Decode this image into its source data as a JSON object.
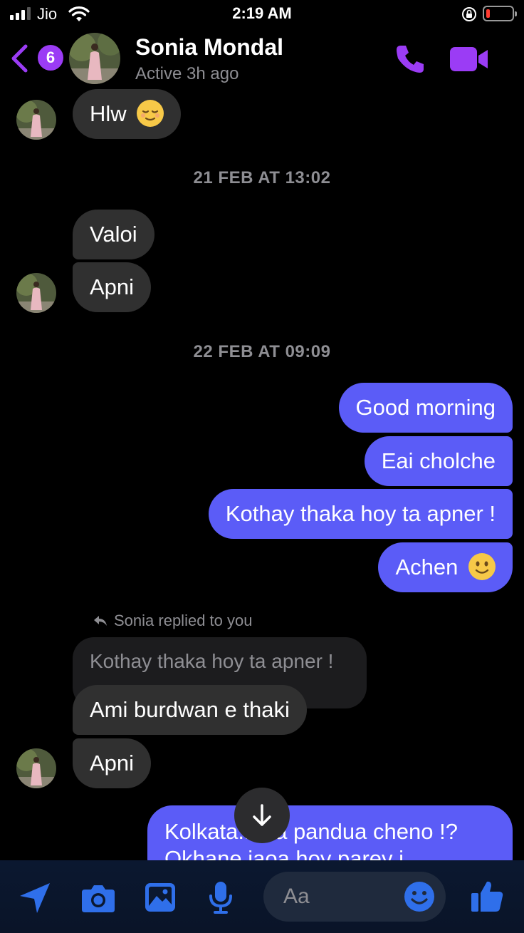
{
  "status_bar": {
    "carrier": "Jio",
    "time": "2:19 AM",
    "battery_color": "#ff3b30"
  },
  "header": {
    "unread_count": "6",
    "name": "Sonia Mondal",
    "status": "Active 3h ago"
  },
  "colors": {
    "accent": "#9b3cf5",
    "outgoing_bubble": "#5b5cf7",
    "incoming_bubble": "#303030"
  },
  "messages": {
    "m1": "Hlw",
    "date1": "21 FEB AT 13:02",
    "m2": "Valoi",
    "m3": "Apni",
    "date2": "22 FEB AT 09:09",
    "m4": "Good morning",
    "m5": "Eai cholche",
    "m6": "Kothay thaka hoy ta apner !",
    "m7": "Achen",
    "reply_label": "Sonia replied to you",
    "quoted": "Kothay thaka hoy ta apner !",
    "m8": "Ami burdwan e thaki",
    "m9": "Apni",
    "m10_line1": "Kolkata... na pandua cheno !?",
    "m10_line2": "Okhane jaoa hoy parey i..."
  },
  "composer": {
    "placeholder": "Aa"
  },
  "icons": [
    "back-chevron-icon",
    "phone-icon",
    "video-camera-icon",
    "location-arrow-icon",
    "camera-icon",
    "image-icon",
    "microphone-icon",
    "smiley-icon",
    "thumbs-up-icon",
    "arrow-down-icon",
    "reply-arrow-icon"
  ]
}
